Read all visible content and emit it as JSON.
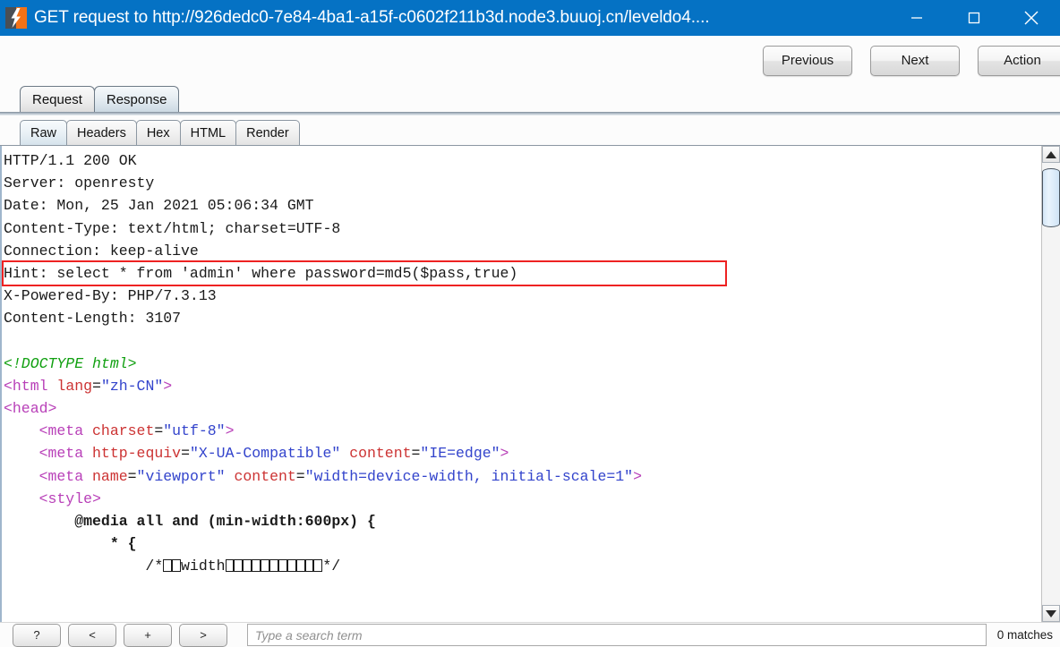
{
  "window": {
    "title": "GET request to http://926dedc0-7e84-4ba1-a15f-c0602f211b3d.node3.buuoj.cn/leveldo4....",
    "icon": "burp-lightning-icon",
    "minimize_label": "—",
    "maximize_label": "☐",
    "close_label": "✕",
    "titlebar_color": "#0572c4"
  },
  "toolbar": {
    "previous_label": "Previous",
    "next_label": "Next",
    "action_label": "Action"
  },
  "outer_tabs": [
    {
      "label": "Request",
      "active": false
    },
    {
      "label": "Response",
      "active": true
    }
  ],
  "inner_tabs": [
    {
      "label": "Raw",
      "active": true
    },
    {
      "label": "Headers",
      "active": false
    },
    {
      "label": "Hex",
      "active": false
    },
    {
      "label": "HTML",
      "active": false
    },
    {
      "label": "Render",
      "active": false
    }
  ],
  "response": {
    "highlight_color": "#ee2222",
    "highlighted_line_index": 5,
    "lines": [
      {
        "text": "HTTP/1.1 200 OK",
        "kind": "plain"
      },
      {
        "text": "Server: openresty",
        "kind": "plain"
      },
      {
        "text": "Date: Mon, 25 Jan 2021 05:06:34 GMT",
        "kind": "plain"
      },
      {
        "text": "Content-Type: text/html; charset=UTF-8",
        "kind": "plain"
      },
      {
        "text": "Connection: keep-alive",
        "kind": "plain"
      },
      {
        "text": "Hint: select * from 'admin' where password=md5($pass,true)",
        "kind": "plain",
        "highlighted": true
      },
      {
        "text": "X-Powered-By: PHP/7.3.13",
        "kind": "plain"
      },
      {
        "text": "Content-Length: 3107",
        "kind": "plain"
      },
      {
        "text": "",
        "kind": "plain"
      },
      {
        "text": "<!DOCTYPE html>",
        "kind": "doctype"
      },
      {
        "kind": "rich",
        "parts": [
          {
            "t": "<html ",
            "c": "tag"
          },
          {
            "t": "lang",
            "c": "attr"
          },
          {
            "t": "=",
            "c": "plain"
          },
          {
            "t": "\"zh-CN\"",
            "c": "val"
          },
          {
            "t": ">",
            "c": "tag"
          }
        ]
      },
      {
        "kind": "rich",
        "parts": [
          {
            "t": "<head>",
            "c": "tag"
          }
        ]
      },
      {
        "kind": "rich",
        "parts": [
          {
            "t": "    <meta ",
            "c": "tag"
          },
          {
            "t": "charset",
            "c": "attr"
          },
          {
            "t": "=",
            "c": "plain"
          },
          {
            "t": "\"utf-8\"",
            "c": "val"
          },
          {
            "t": ">",
            "c": "tag"
          }
        ]
      },
      {
        "kind": "rich",
        "parts": [
          {
            "t": "    <meta ",
            "c": "tag"
          },
          {
            "t": "http-equiv",
            "c": "attr"
          },
          {
            "t": "=",
            "c": "plain"
          },
          {
            "t": "\"X-UA-Compatible\"",
            "c": "val"
          },
          {
            "t": " ",
            "c": "plain"
          },
          {
            "t": "content",
            "c": "attr"
          },
          {
            "t": "=",
            "c": "plain"
          },
          {
            "t": "\"IE=edge\"",
            "c": "val"
          },
          {
            "t": ">",
            "c": "tag"
          }
        ]
      },
      {
        "kind": "rich",
        "parts": [
          {
            "t": "    <meta ",
            "c": "tag"
          },
          {
            "t": "name",
            "c": "attr"
          },
          {
            "t": "=",
            "c": "plain"
          },
          {
            "t": "\"viewport\"",
            "c": "val"
          },
          {
            "t": " ",
            "c": "plain"
          },
          {
            "t": "content",
            "c": "attr"
          },
          {
            "t": "=",
            "c": "plain"
          },
          {
            "t": "\"width=device-width, initial-scale=1\"",
            "c": "val"
          },
          {
            "t": ">",
            "c": "tag"
          }
        ]
      },
      {
        "kind": "rich",
        "parts": [
          {
            "t": "    <style>",
            "c": "tag"
          }
        ]
      },
      {
        "kind": "rich",
        "parts": [
          {
            "t": "        @media all and (min-width:600px) {",
            "c": "css"
          }
        ]
      },
      {
        "kind": "rich",
        "parts": [
          {
            "t": "            * {",
            "c": "css"
          }
        ]
      },
      {
        "kind": "rich",
        "parts": [
          {
            "t": "                /*",
            "c": "plain"
          },
          {
            "t": "",
            "c": "tofu",
            "n": 2
          },
          {
            "t": "width",
            "c": "plain"
          },
          {
            "t": "",
            "c": "tofu",
            "n": 11
          },
          {
            "t": "*/",
            "c": "plain"
          }
        ]
      }
    ]
  },
  "scrollbar": {
    "up_arrow": "scroll-up-arrow",
    "down_arrow": "scroll-down-arrow",
    "thumb": "scroll-thumb"
  },
  "footer": {
    "buttons": [
      {
        "label": "?",
        "name": "help-button"
      },
      {
        "label": "<",
        "name": "previous-match-button"
      },
      {
        "label": "+",
        "name": "add-button"
      },
      {
        "label": ">",
        "name": "next-match-button"
      }
    ],
    "search_placeholder": "Type a search term",
    "search_value": "",
    "matches_label": "0 matches"
  }
}
